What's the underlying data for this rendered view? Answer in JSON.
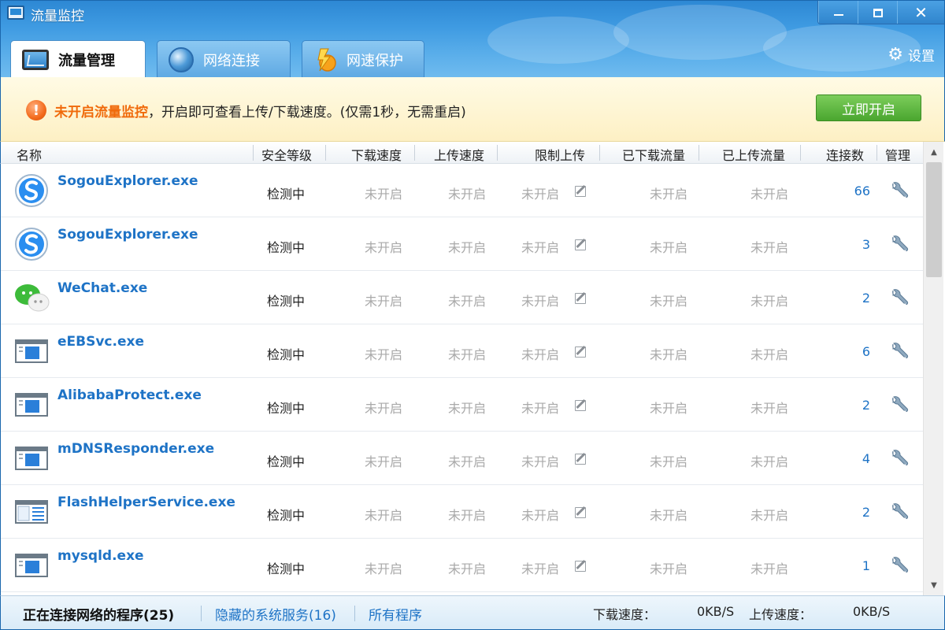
{
  "window": {
    "title": "流量监控",
    "controls": {
      "minimize": "minimize",
      "maximize": "maximize",
      "close": "close"
    }
  },
  "tabs": [
    {
      "label": "流量管理",
      "icon": "monitor-icon",
      "active": true
    },
    {
      "label": "网络连接",
      "icon": "globe-icon",
      "active": false
    },
    {
      "label": "网速保护",
      "icon": "lightning-icon",
      "active": false
    }
  ],
  "settings_label": "设置",
  "banner": {
    "highlight": "未开启流量监控",
    "message": "，开启即可查看上传/下载速度。(仅需1秒，无需重启)",
    "button_label": "立即开启",
    "icon": "warning-icon"
  },
  "table": {
    "columns": [
      "名称",
      "安全等级",
      "下载速度",
      "上传速度",
      "限制上传",
      "已下载流量",
      "已上传流量",
      "连接数",
      "管理"
    ],
    "rows": [
      {
        "name": "SogouExplorer.exe",
        "icon": "sogou-icon",
        "security": "检测中",
        "down_speed": "未开启",
        "up_speed": "未开启",
        "limit_upload": "未开启",
        "downloaded": "未开启",
        "uploaded": "未开启",
        "connections": "66"
      },
      {
        "name": "SogouExplorer.exe",
        "icon": "sogou-icon",
        "security": "检测中",
        "down_speed": "未开启",
        "up_speed": "未开启",
        "limit_upload": "未开启",
        "downloaded": "未开启",
        "uploaded": "未开启",
        "connections": "3"
      },
      {
        "name": "WeChat.exe",
        "icon": "wechat-icon",
        "security": "检测中",
        "down_speed": "未开启",
        "up_speed": "未开启",
        "limit_upload": "未开启",
        "downloaded": "未开启",
        "uploaded": "未开启",
        "connections": "2"
      },
      {
        "name": "eEBSvc.exe",
        "icon": "window-app-icon",
        "security": "检测中",
        "down_speed": "未开启",
        "up_speed": "未开启",
        "limit_upload": "未开启",
        "downloaded": "未开启",
        "uploaded": "未开启",
        "connections": "6"
      },
      {
        "name": "AlibabaProtect.exe",
        "icon": "window-app-icon",
        "security": "检测中",
        "down_speed": "未开启",
        "up_speed": "未开启",
        "limit_upload": "未开启",
        "downloaded": "未开启",
        "uploaded": "未开启",
        "connections": "2"
      },
      {
        "name": "mDNSResponder.exe",
        "icon": "window-app-icon",
        "security": "检测中",
        "down_speed": "未开启",
        "up_speed": "未开启",
        "limit_upload": "未开启",
        "downloaded": "未开启",
        "uploaded": "未开启",
        "connections": "4"
      },
      {
        "name": "FlashHelperService.exe",
        "icon": "service-app-icon",
        "security": "检测中",
        "down_speed": "未开启",
        "up_speed": "未开启",
        "limit_upload": "未开启",
        "downloaded": "未开启",
        "uploaded": "未开启",
        "connections": "2"
      },
      {
        "name": "mysqld.exe",
        "icon": "window-app-icon",
        "security": "检测中",
        "down_speed": "未开启",
        "up_speed": "未开启",
        "limit_upload": "未开启",
        "downloaded": "未开启",
        "uploaded": "未开启",
        "connections": "1"
      }
    ]
  },
  "statusbar": {
    "tab_active": "正在连接网络的程序(25)",
    "tab_hidden": "隐藏的系统服务(16)",
    "tab_all": "所有程序",
    "down_label": "下载速度：",
    "down_value": "0KB/S",
    "up_label": "上传速度：",
    "up_value": "0KB/S"
  },
  "colors": {
    "accent": "#2d88d4",
    "link": "#1e73c6",
    "warning": "#f06a0b",
    "button_green": "#4aa62f"
  }
}
